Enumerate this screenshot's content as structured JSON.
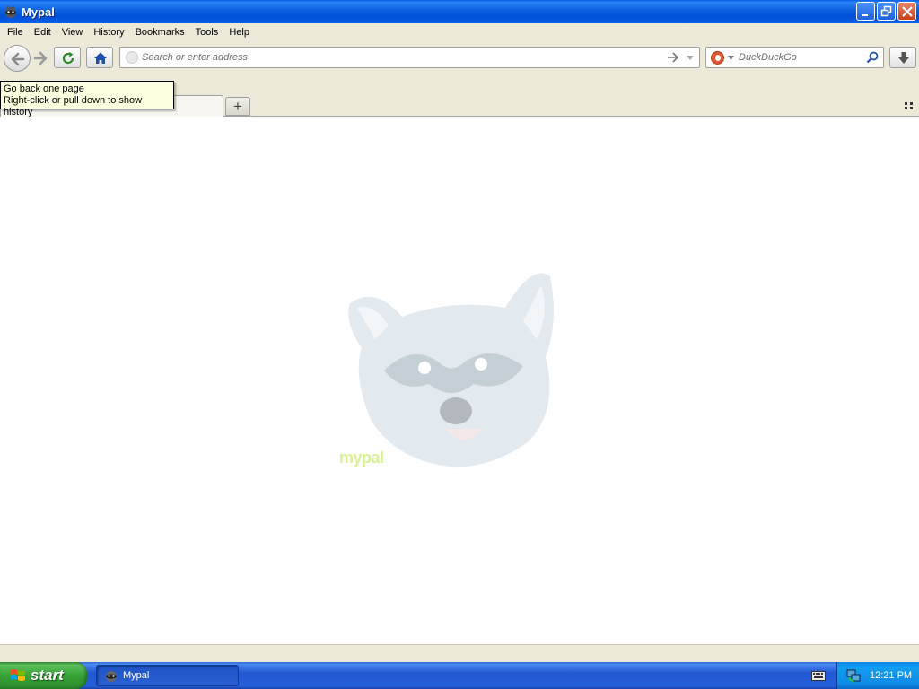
{
  "window": {
    "title": "Mypal"
  },
  "menu": {
    "items": [
      {
        "label": "File"
      },
      {
        "label": "Edit"
      },
      {
        "label": "View"
      },
      {
        "label": "History"
      },
      {
        "label": "Bookmarks"
      },
      {
        "label": "Tools"
      },
      {
        "label": "Help"
      }
    ]
  },
  "urlbar": {
    "placeholder": "Search or enter address"
  },
  "searchbar": {
    "placeholder": "DuckDuckGo"
  },
  "tooltip": {
    "line1": "Go back one page",
    "line2": "Right-click or pull down to show history"
  },
  "tabs": {
    "new_tab_label": "+"
  },
  "content": {
    "watermark_text": "mypal"
  },
  "taskbar": {
    "start_label": "start",
    "task_label": "Mypal",
    "clock": "12:21 PM"
  },
  "icons": {
    "back": "arrow-left-icon",
    "forward": "arrow-right-icon",
    "reload": "reload-icon",
    "home": "home-icon",
    "go": "go-arrow-icon",
    "search": "magnifier-icon",
    "download": "download-icon"
  },
  "colors": {
    "titlebar": "#0a5fe8",
    "chrome": "#ece9d8",
    "taskbar": "#245edb",
    "start": "#37a237",
    "tooltip": "#ffffe1"
  }
}
